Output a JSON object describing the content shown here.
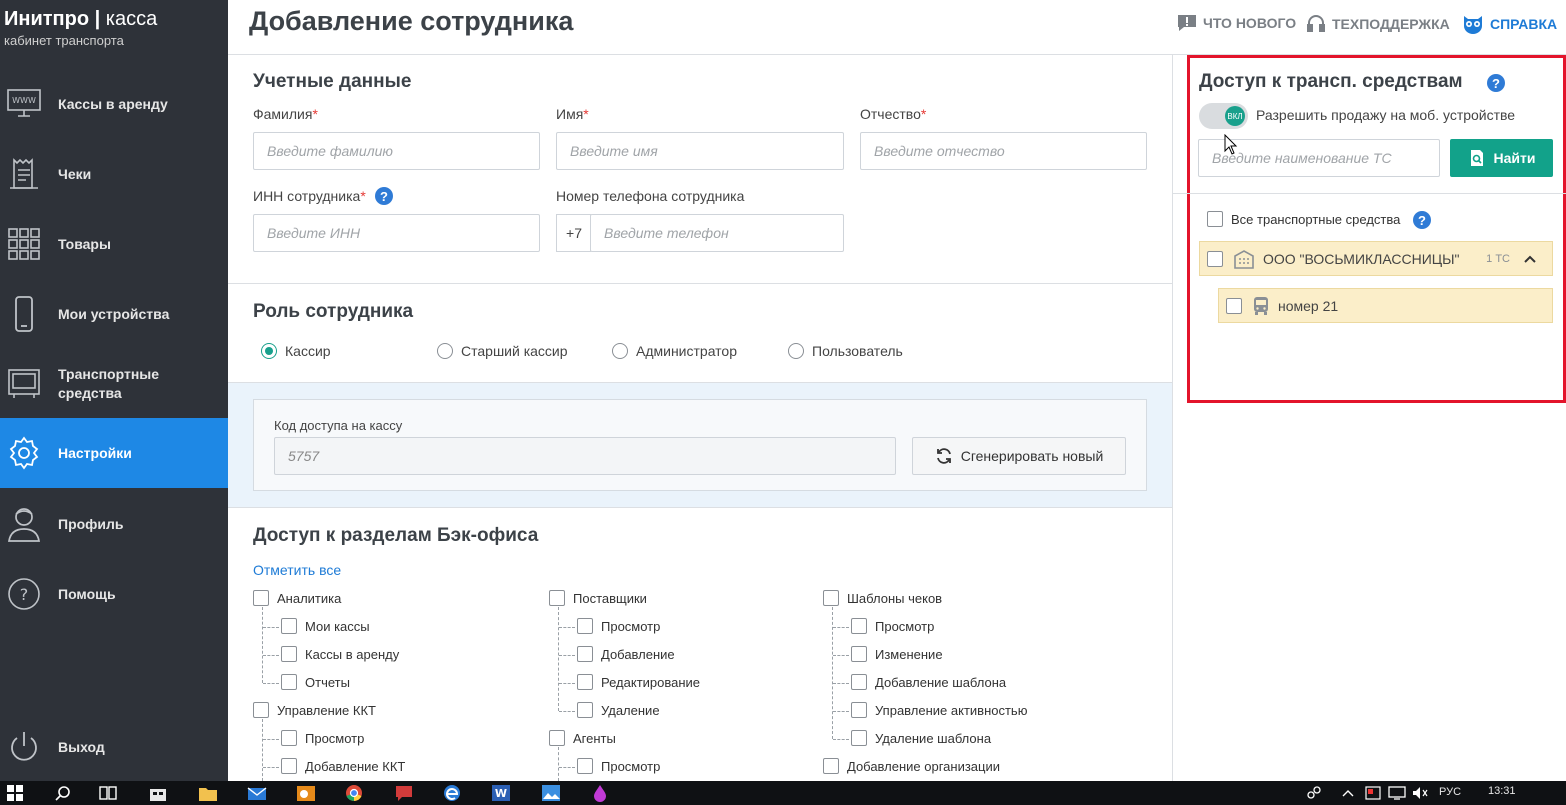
{
  "brand": {
    "name_bold": "Инитпро",
    "separator": "|",
    "name_light": "касса",
    "subtitle": "кабинет транспорта"
  },
  "sidebar": {
    "items": [
      {
        "label": "Кассы в аренду",
        "icon": "www-monitor-icon"
      },
      {
        "label": "Чеки",
        "icon": "receipt-icon"
      },
      {
        "label": "Товары",
        "icon": "grid-icon"
      },
      {
        "label": "Мои устройства",
        "icon": "phone-icon"
      },
      {
        "label": "Транспортные средства",
        "icon": "bus-front-icon"
      },
      {
        "label": "Настройки",
        "icon": "gear-icon",
        "active": true
      },
      {
        "label": "Профиль",
        "icon": "user-icon"
      },
      {
        "label": "Помощь",
        "icon": "question-icon"
      }
    ],
    "logout": "Выход"
  },
  "header": {
    "title": "Добавление сотрудника",
    "links": {
      "whats_new": "ЧТО НОВОГО",
      "support": "ТЕХПОДДЕРЖКА",
      "help": "СПРАВКА"
    }
  },
  "credentials": {
    "title": "Учетные данные",
    "last_name": {
      "label": "Фамилия",
      "required": "*",
      "placeholder": "Введите фамилию"
    },
    "first_name": {
      "label": "Имя",
      "required": "*",
      "placeholder": "Введите имя"
    },
    "middle_name": {
      "label": "Отчество",
      "required": "*",
      "placeholder": "Введите отчество"
    },
    "inn": {
      "label": "ИНН сотрудника",
      "required": "*",
      "placeholder": "Введите ИНН",
      "help": "?"
    },
    "phone": {
      "label": "Номер телефона сотрудника",
      "prefix": "+7",
      "placeholder": "Введите телефон"
    }
  },
  "role": {
    "title": "Роль сотрудника",
    "options": [
      {
        "label": "Кассир",
        "selected": true
      },
      {
        "label": "Старший кассир",
        "selected": false
      },
      {
        "label": "Администратор",
        "selected": false
      },
      {
        "label": "Пользователь",
        "selected": false
      }
    ],
    "access_code": {
      "label": "Код доступа на кассу",
      "value": "5757",
      "generate_label": "Сгенерировать новый"
    }
  },
  "backoffice": {
    "title": "Доступ к разделам Бэк-офиса",
    "select_all": "Отметить все",
    "col1": {
      "analytics": "Аналитика",
      "analytics_items": [
        "Мои кассы",
        "Кассы в аренду",
        "Отчеты"
      ],
      "kkt": "Управление ККТ",
      "kkt_items": [
        "Просмотр",
        "Добавление ККТ"
      ]
    },
    "col2": {
      "suppliers": "Поставщики",
      "suppliers_items": [
        "Просмотр",
        "Добавление",
        "Редактирование",
        "Удаление"
      ],
      "agents": "Агенты",
      "agents_items": [
        "Просмотр"
      ]
    },
    "col3": {
      "templates": "Шаблоны чеков",
      "templates_items": [
        "Просмотр",
        "Изменение",
        "Добавление шаблона",
        "Управление активностью",
        "Удаление шаблона"
      ],
      "add_org": "Добавление организации"
    }
  },
  "transport_access": {
    "title": "Доступ к трансп. средствам",
    "help": "?",
    "toggle_text": "ВКЛ",
    "allow_mobile": "Разрешить продажу на моб. устройстве",
    "search_placeholder": "Введите наименование ТС",
    "find_label": "Найти",
    "all_vehicles": "Все транспортные средства",
    "org_name": "ООО \"ВОСЬМИКЛАССНИЦЫ\"",
    "org_count": "1 ТС",
    "vehicle": "номер 21"
  },
  "taskbar": {
    "lang": "РУС",
    "time": "13:31"
  },
  "colors": {
    "sidebar_bg": "#2e3239",
    "active_blue": "#1e88e5",
    "teal": "#12a28a",
    "highlight_red": "#e3142b",
    "org_bg": "#fbeec9"
  }
}
